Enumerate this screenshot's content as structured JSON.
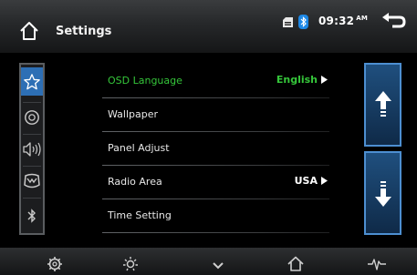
{
  "header": {
    "title": "Settings",
    "time": "09:32",
    "ampm": "AM",
    "icons": [
      "home-icon",
      "sd-card-icon",
      "bluetooth-icon",
      "back-arrow-icon"
    ]
  },
  "sidebar": {
    "items": [
      {
        "icon": "star-icon",
        "active": true
      },
      {
        "icon": "disc-icon",
        "active": false
      },
      {
        "icon": "speaker-icon",
        "active": false
      },
      {
        "icon": "steering-wheel-icon",
        "active": false
      },
      {
        "icon": "bluetooth-icon",
        "active": false
      }
    ]
  },
  "menu": {
    "items": [
      {
        "label": "OSD Language",
        "value": "English",
        "highlighted": true
      },
      {
        "label": "Wallpaper",
        "value": ""
      },
      {
        "label": "Panel Adjust",
        "value": ""
      },
      {
        "label": "Radio Area",
        "value": "USA"
      },
      {
        "label": "Time Setting",
        "value": ""
      }
    ]
  },
  "scroll": {
    "up_icon": "arrow-up-icon",
    "down_icon": "arrow-down-icon"
  },
  "bottom_bar": {
    "icons": [
      "gear-icon",
      "brightness-icon",
      "chevron-down-icon",
      "home-icon",
      "equalizer-icon"
    ]
  },
  "colors": {
    "accent_blue": "#2d6fb5",
    "highlight_green": "#35c63a",
    "background": "#000000"
  }
}
